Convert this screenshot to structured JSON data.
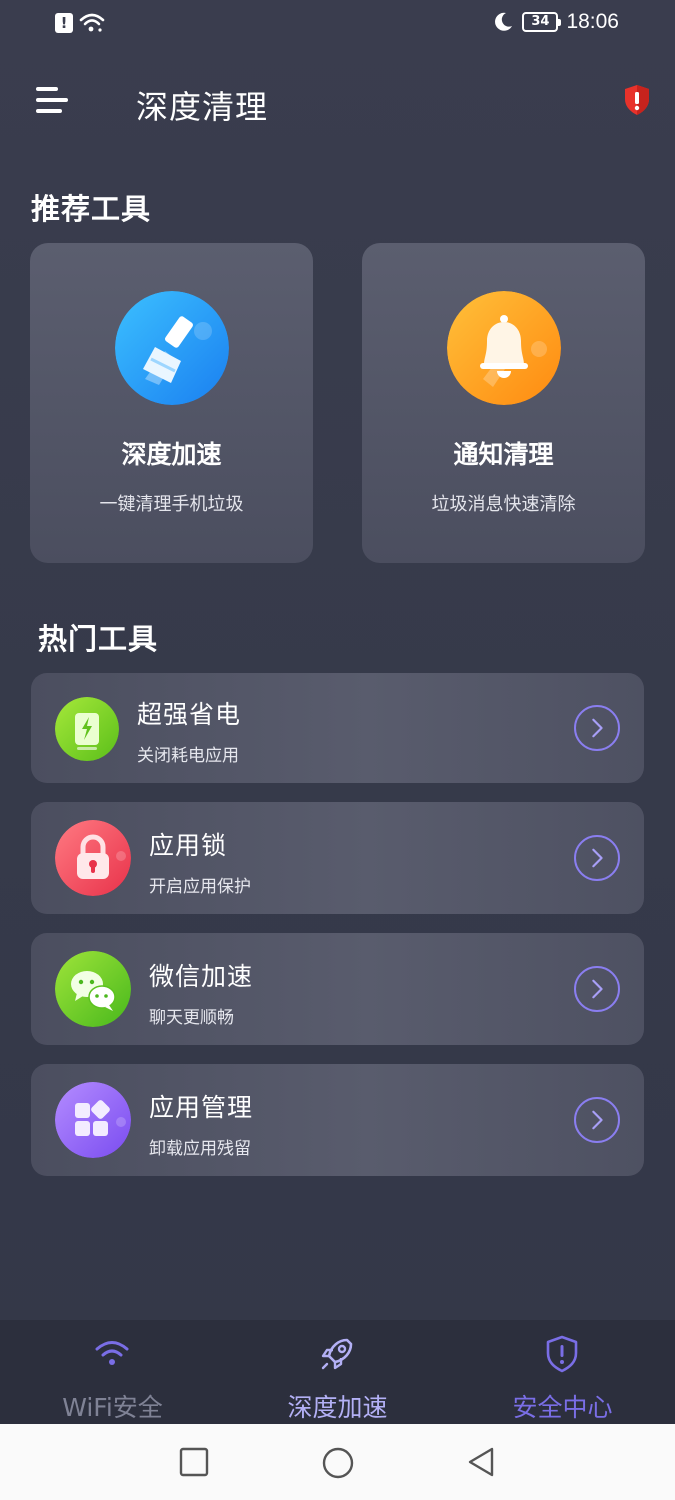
{
  "status_bar": {
    "time": "18:06",
    "battery": "34",
    "alert_glyph": "!"
  },
  "header": {
    "title": "深度清理",
    "menu_icon": "menu-icon",
    "alert_icon": "shield-alert-icon"
  },
  "recommended": {
    "section_title": "推荐工具",
    "cards": [
      {
        "title": "深度加速",
        "subtitle": "一键清理手机垃圾",
        "icon": "broom-icon",
        "color": "#2196f3"
      },
      {
        "title": "通知清理",
        "subtitle": "垃圾消息快速清除",
        "icon": "bell-icon",
        "color": "#ff9800"
      }
    ]
  },
  "hot_tools": {
    "section_title": "热门工具",
    "items": [
      {
        "title": "超强省电",
        "subtitle": "关闭耗电应用",
        "icon": "battery-save-icon",
        "color": "#7ed321"
      },
      {
        "title": "应用锁",
        "subtitle": "开启应用保护",
        "icon": "lock-icon",
        "color": "#f44d5a"
      },
      {
        "title": "微信加速",
        "subtitle": "聊天更顺畅",
        "icon": "wechat-icon",
        "color": "#6cd22a"
      },
      {
        "title": "应用管理",
        "subtitle": "卸载应用残留",
        "icon": "apps-icon",
        "color": "#8b5cf6"
      }
    ]
  },
  "bottom_nav": {
    "items": [
      {
        "label": "WiFi安全",
        "icon": "wifi-icon",
        "color": "#7f8295"
      },
      {
        "label": "深度加速",
        "icon": "rocket-icon",
        "color": "#b3b0f5"
      },
      {
        "label": "安全中心",
        "icon": "shield-icon",
        "color": "#7a6ee6"
      }
    ]
  },
  "system_nav": {
    "buttons": [
      "recents-button",
      "home-button",
      "back-button"
    ]
  }
}
